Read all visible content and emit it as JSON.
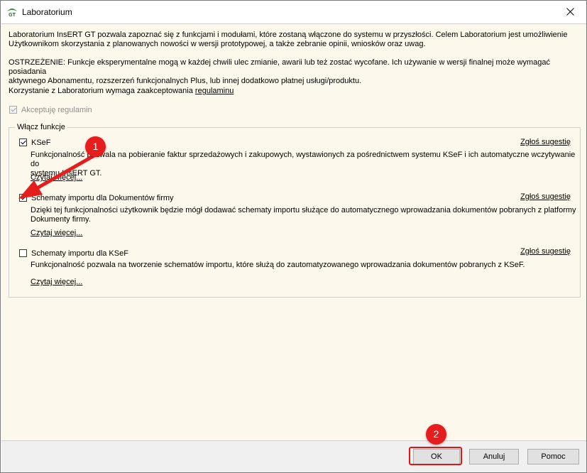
{
  "window": {
    "title": "Laboratorium"
  },
  "intro": {
    "p1_line1": "Laboratorium InsERT GT pozwala zapoznać się z funkcjami i modułami, które zostaną włączone do systemu w przyszłości. Celem Laboratorium jest umożliwienie",
    "p1_line2": "Użytkownikom skorzystania z planowanych nowości w wersji prototypowej, a także zebranie opinii, wniosków oraz uwag.",
    "p2_line1": "OSTRZEŻENIE: Funkcje eksperymentalne mogą w każdej chwili ulec zmianie, awarii lub też zostać wycofane. Ich używanie w wersji finalnej może wymagać posiadania",
    "p2_line2": "aktywnego Abonamentu, rozszerzeń funkcjonalnych Plus, lub innej dodatkowo płatnej usługi/produktu.",
    "p3_prefix": "Korzystanie z Laboratorium wymaga zaakceptowania ",
    "p3_link": "regulaminu"
  },
  "accept": {
    "label": "Akceptuję regulamin",
    "checked": true
  },
  "group": {
    "legend": "Włącz funkcje"
  },
  "features": [
    {
      "label": "KSeF",
      "checked": true,
      "desc_line1": "Funkcjonalność pozwala na pobieranie faktur sprzedażowych i zakupowych, wystawionych za pośrednictwem systemu KSeF i ich automatyczne wczytywanie do",
      "desc_line2": "systemu InsERT GT.",
      "read_more": "Czytaj więcej...",
      "suggest": "Zgłoś sugestię"
    },
    {
      "label": "Schematy importu dla Dokumentów firmy",
      "checked": true,
      "desc_line1": "Dzięki tej funkcjonalności użytkownik będzie mógł dodawać schematy importu służące do automatycznego wprowadzania dokumentów pobranych z platformy",
      "desc_line2": "Dokumenty firmy.",
      "read_more": "Czytaj więcej...",
      "suggest": "Zgłoś sugestię"
    },
    {
      "label": "Schematy importu dla KSeF",
      "checked": false,
      "desc_line1": "Funkcjonalność pozwala na tworzenie schematów importu, które służą do zautomatyzowanego wprowadzania dokumentów pobranych z KSeF.",
      "read_more": "Czytaj więcej...",
      "suggest": "Zgłoś sugestię"
    }
  ],
  "buttons": {
    "ok": "OK",
    "cancel": "Anuluj",
    "help": "Pomoc"
  },
  "annotations": {
    "badge1": "1",
    "badge2": "2"
  },
  "colors": {
    "annotation": "#e51d1d",
    "content_bg": "#fdf8ec",
    "footer_bg": "#f0f0f0"
  }
}
